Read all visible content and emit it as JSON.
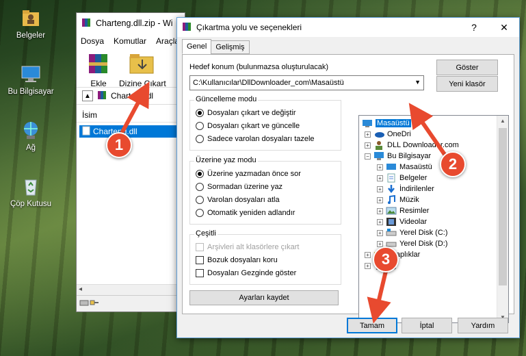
{
  "desktop": {
    "icons": [
      {
        "label": "Belgeler",
        "icon": "folder-user-icon"
      },
      {
        "label": "Bu Bilgisayar",
        "icon": "computer-icon"
      },
      {
        "label": "Ağ",
        "icon": "network-icon"
      },
      {
        "label": "Çöp Kutusu",
        "icon": "recycle-bin-icon"
      }
    ]
  },
  "winrar": {
    "title": "Charteng.dll.zip - Wi",
    "menu": [
      "Dosya",
      "Komutlar",
      "Araçla"
    ],
    "toolbar": {
      "add_label": "Ekle",
      "extract_label": "Dizine Çıkart"
    },
    "address": "Charteng.dl",
    "column_name": "İsim",
    "file_name": "Charteng.dll"
  },
  "dialog": {
    "title": "Çıkartma yolu ve seçenekleri",
    "help_btn": "?",
    "close_btn": "✕",
    "tabs": [
      "Genel",
      "Gelişmiş"
    ],
    "dest_label": "Hedef konum (bulunmazsa oluşturulacak)",
    "dest_value": "C:\\Kullanıcılar\\DllDownloader_com\\Masaüstü",
    "show_btn": "Göster",
    "new_folder_btn": "Yeni klasör",
    "update_mode": {
      "title": "Güncelleme modu",
      "options": [
        "Dosyaları çıkart ve değiştir",
        "Dosyaları çıkart ve güncelle",
        "Sadece varolan dosyaları tazele"
      ],
      "selected": 0
    },
    "overwrite_mode": {
      "title": "Üzerine yaz modu",
      "options": [
        "Üzerine yazmadan önce sor",
        "Sormadan üzerine yaz",
        "Varolan dosyaları atla",
        "Otomatik yeniden adlandır"
      ],
      "selected": 0
    },
    "misc": {
      "title": "Çeşitli",
      "options": [
        "Arşivleri alt klasörlere çıkart",
        "Bozuk dosyaları koru",
        "Dosyaları Gezginde göster"
      ]
    },
    "save_btn": "Ayarları kaydet",
    "tree": [
      {
        "label": "Masaüstü",
        "icon": "desktop-icon",
        "selected": true
      },
      {
        "label": "OneDri",
        "icon": "onedrive-icon"
      },
      {
        "label": "DLL Downloader.com",
        "icon": "user-icon"
      },
      {
        "label": "Bu Bilgisayar",
        "icon": "computer-icon"
      },
      {
        "label": "Masaüstü",
        "icon": "desktop-icon"
      },
      {
        "label": "Belgeler",
        "icon": "documents-icon"
      },
      {
        "label": "İndirilenler",
        "icon": "download-icon"
      },
      {
        "label": "Müzik",
        "icon": "music-icon"
      },
      {
        "label": "Resimler",
        "icon": "pictures-icon"
      },
      {
        "label": "Videolar",
        "icon": "videos-icon"
      },
      {
        "label": "Yerel Disk (C:)",
        "icon": "drive-c-icon"
      },
      {
        "label": "Yerel Disk (D:)",
        "icon": "drive-d-icon"
      },
      {
        "label": "Kitaplıklar",
        "icon": "libraries-icon"
      },
      {
        "label": "Ağ",
        "icon": "network-icon"
      }
    ],
    "ok_btn": "Tamam",
    "cancel_btn": "İptal",
    "help_footer_btn": "Yardım"
  },
  "markers": [
    "1",
    "2",
    "3"
  ],
  "colors": {
    "accent": "#0078d7",
    "marker": "#e84a2f"
  }
}
